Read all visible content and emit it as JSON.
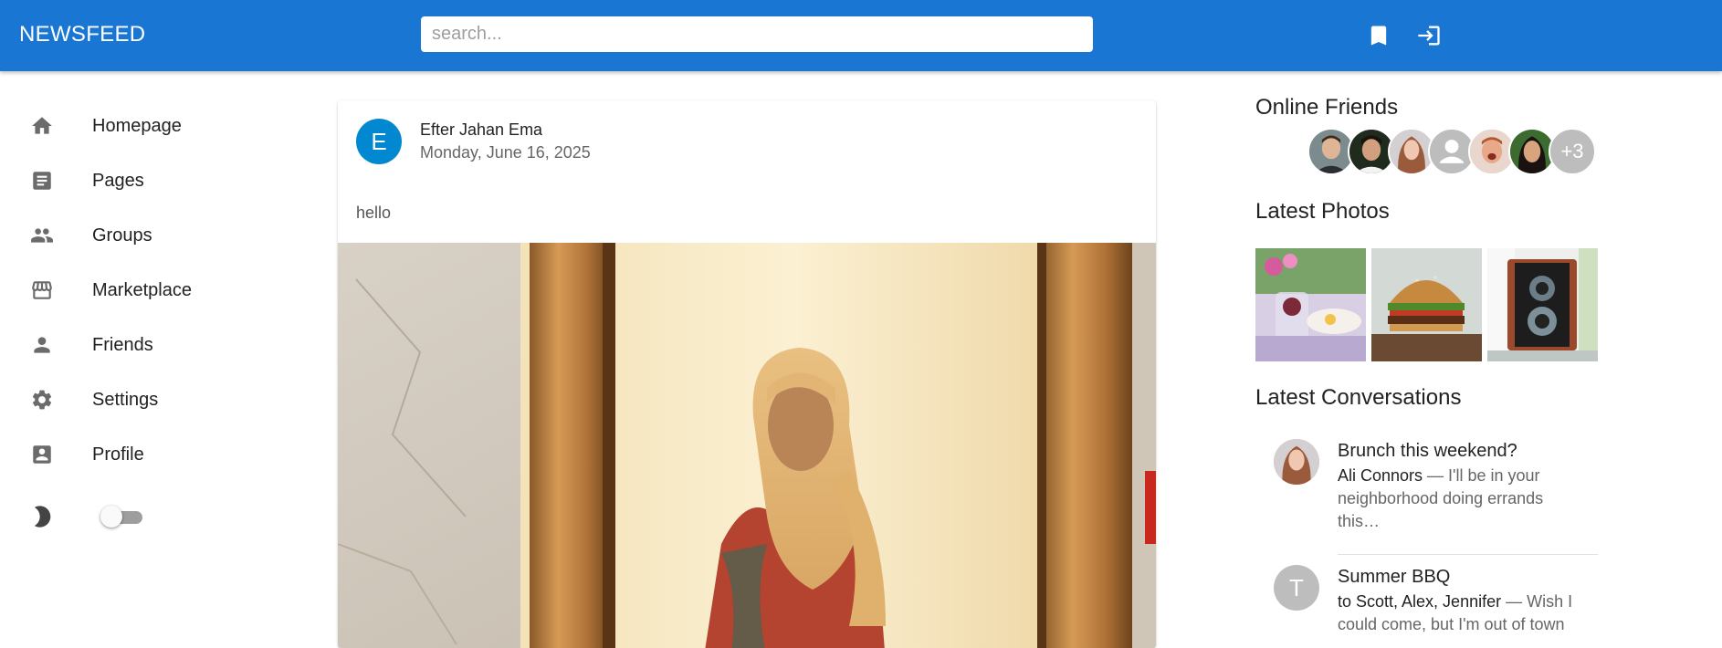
{
  "appbar": {
    "brand": "NEWSFEED",
    "search_placeholder": "search...",
    "bookmark_icon": "bookmark-icon",
    "login_icon": "login-icon",
    "color": "#1976d2"
  },
  "sidebar": {
    "items": [
      {
        "label": "Homepage",
        "icon": "home-icon"
      },
      {
        "label": "Pages",
        "icon": "article-icon"
      },
      {
        "label": "Groups",
        "icon": "groups-icon"
      },
      {
        "label": "Marketplace",
        "icon": "storefront-icon"
      },
      {
        "label": "Friends",
        "icon": "person-icon"
      },
      {
        "label": "Settings",
        "icon": "gear-icon"
      },
      {
        "label": "Profile",
        "icon": "account-box-icon"
      }
    ],
    "dark_mode_icon": "moon-icon",
    "dark_mode_on": false
  },
  "post": {
    "avatar_letter": "E",
    "avatar_color": "#0288d1",
    "author": "Efter Jahan Ema",
    "date": "Monday, June 16, 2025",
    "body": "hello"
  },
  "online_friends": {
    "title": "Online Friends",
    "more": "+3"
  },
  "latest_photos": {
    "title": "Latest Photos"
  },
  "latest_conversations": {
    "title": "Latest Conversations",
    "items": [
      {
        "title": "Brunch this weekend?",
        "who": "Ali Connors",
        "text": " — I'll be in your neighborhood doing errands this…"
      },
      {
        "avatar_letter": "T",
        "title": "Summer BBQ",
        "who": "to Scott, Alex, Jennifer",
        "text": " — Wish I could come, but I'm out of town"
      }
    ]
  }
}
